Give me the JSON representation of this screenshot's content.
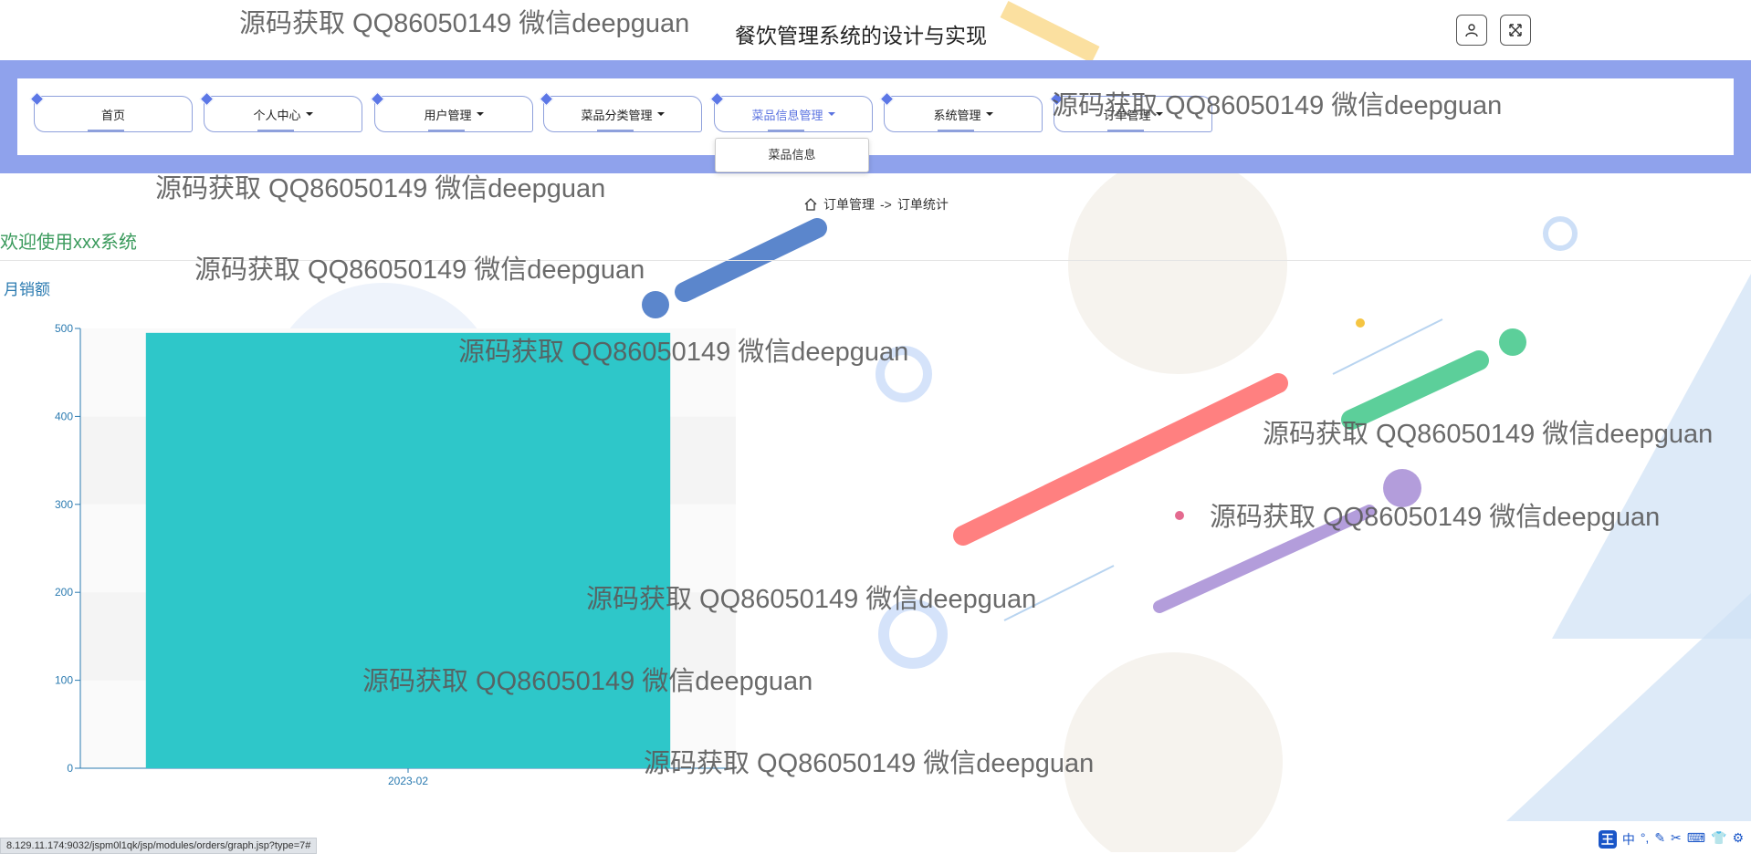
{
  "header": {
    "title": "餐饮管理系统的设计与实现",
    "user_icon": "user-icon",
    "fullscreen_icon": "fullscreen-icon"
  },
  "nav": {
    "items": [
      {
        "label": "首页",
        "has_caret": false
      },
      {
        "label": "个人中心",
        "has_caret": true
      },
      {
        "label": "用户管理",
        "has_caret": true
      },
      {
        "label": "菜品分类管理",
        "has_caret": true
      },
      {
        "label": "菜品信息管理",
        "has_caret": true,
        "active": true
      },
      {
        "label": "系统管理",
        "has_caret": true
      },
      {
        "label": "订单管理",
        "has_caret": true
      }
    ],
    "dropdown_item": "菜品信息"
  },
  "breadcrumb": {
    "home_icon": "home-icon",
    "section": "订单管理",
    "separator": "->",
    "page": "订单统计"
  },
  "welcome": "欢迎使用xxx系统",
  "chart_data": {
    "type": "bar",
    "title": "月销额",
    "categories": [
      "2023-02"
    ],
    "values": [
      495
    ],
    "ylim": [
      0,
      500
    ],
    "yticks": [
      0,
      100,
      200,
      300,
      400,
      500
    ],
    "bar_color": "#2ec7c9",
    "grid": true
  },
  "watermark": "源码获取 QQ86050149 微信deepguan",
  "status_url": "8.129.11.174:9032/jspm0l1qk/jsp/modules/orders/graph.jsp?type=7#",
  "tray": [
    "中",
    "°,",
    "✎",
    "✂",
    "⌨",
    "👕",
    "⚙"
  ],
  "tray_ime": "王",
  "colors": {
    "nav_band": "#8fa2ec",
    "accent": "#5b73e0",
    "welcome": "#3a9a5c",
    "axis": "#2a7ab0"
  }
}
